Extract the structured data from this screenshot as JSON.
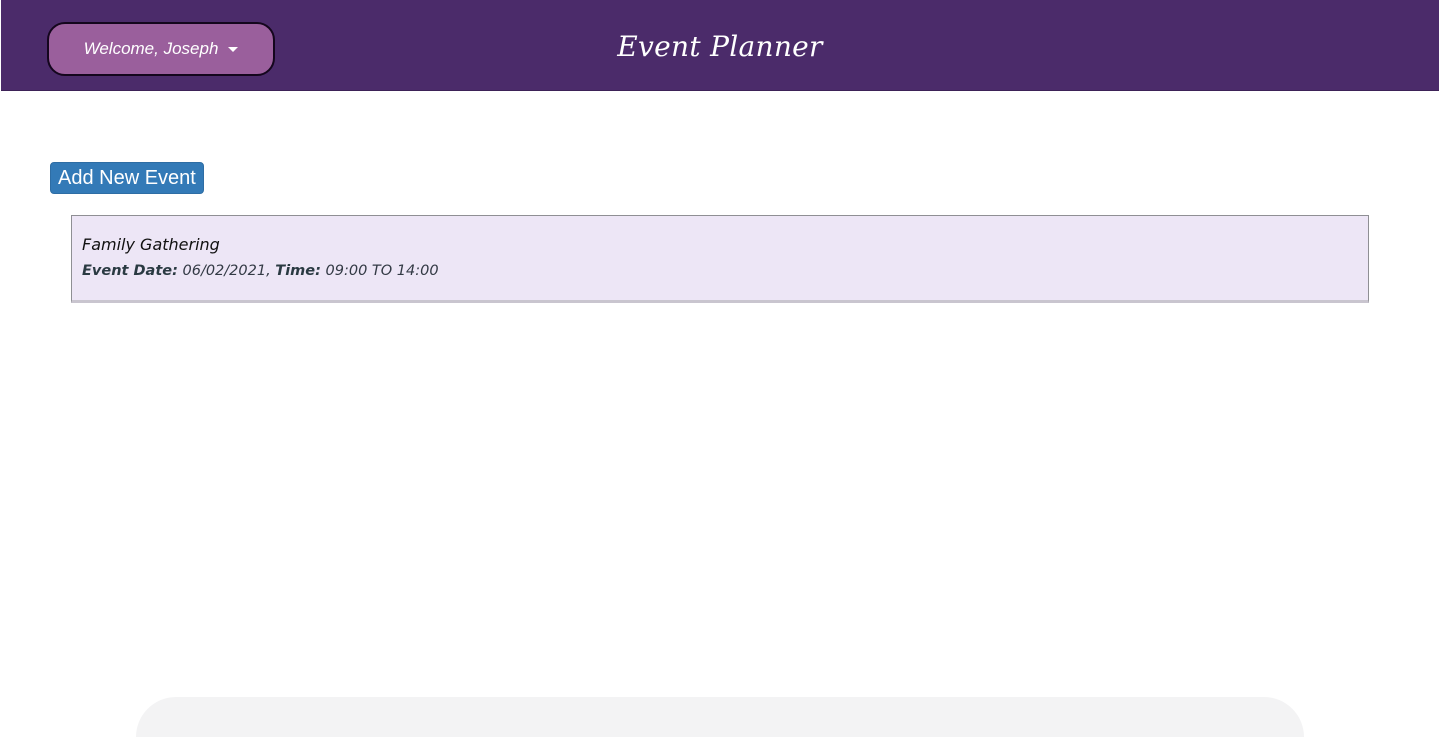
{
  "header": {
    "welcome_label": "Welcome, Joseph",
    "app_title": "Event Planner",
    "background_color": "#4b2b6a"
  },
  "toolbar": {
    "add_event_label": "Add New Event"
  },
  "events": [
    {
      "name": "Family Gathering",
      "date_label": "Event Date:",
      "date_value": "06/02/2021,",
      "time_label": "Time:",
      "time_value": "09:00 TO 14:00"
    }
  ],
  "icons": {
    "welcome_dropdown": "caret-down-icon"
  }
}
